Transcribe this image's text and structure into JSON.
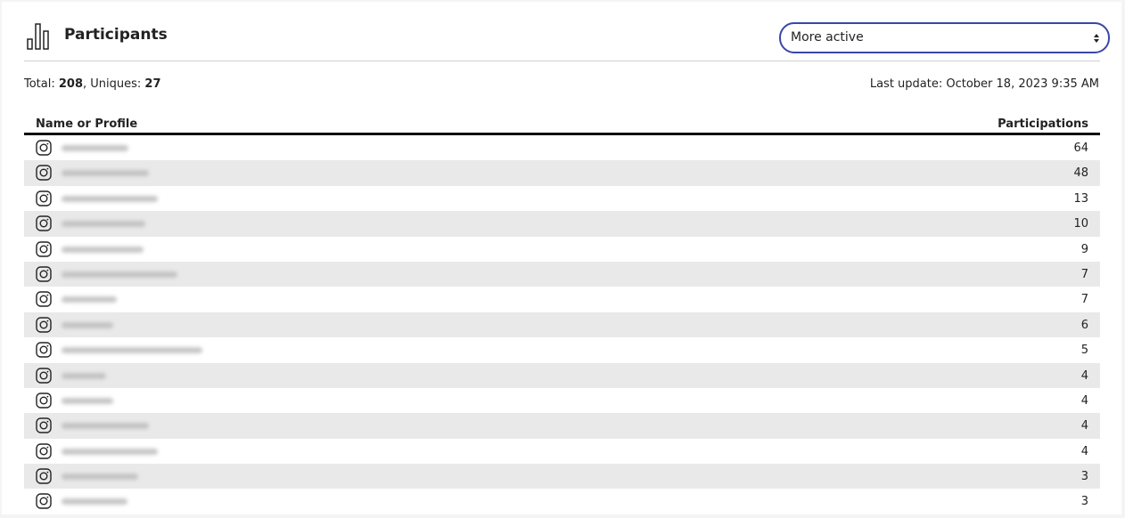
{
  "header": {
    "title": "Participants",
    "icon": "bar-chart-icon",
    "sort_select": {
      "selected": "More active"
    }
  },
  "summary": {
    "total_label": "Total: ",
    "total": "208",
    "uniques_label": ", Uniques: ",
    "uniques": "27",
    "last_update": "Last update: October 18, 2023 9:35 AM"
  },
  "table": {
    "columns": [
      "Name or Profile",
      "Participations"
    ],
    "rows": [
      {
        "icon": "instagram-icon",
        "count": "64"
      },
      {
        "icon": "instagram-icon",
        "count": "48"
      },
      {
        "icon": "instagram-icon",
        "count": "13"
      },
      {
        "icon": "instagram-icon",
        "count": "10"
      },
      {
        "icon": "instagram-icon",
        "count": "9"
      },
      {
        "icon": "instagram-icon",
        "count": "7"
      },
      {
        "icon": "instagram-icon",
        "count": "7"
      },
      {
        "icon": "instagram-icon",
        "count": "6"
      },
      {
        "icon": "instagram-icon",
        "count": "5"
      },
      {
        "icon": "instagram-icon",
        "count": "4"
      },
      {
        "icon": "instagram-icon",
        "count": "4"
      },
      {
        "icon": "instagram-icon",
        "count": "4"
      },
      {
        "icon": "instagram-icon",
        "count": "4"
      },
      {
        "icon": "instagram-icon",
        "count": "3"
      },
      {
        "icon": "instagram-icon",
        "count": "3"
      }
    ]
  },
  "colors": {
    "accent": "#3a46a8",
    "row_alt": "#e9e9e9"
  }
}
